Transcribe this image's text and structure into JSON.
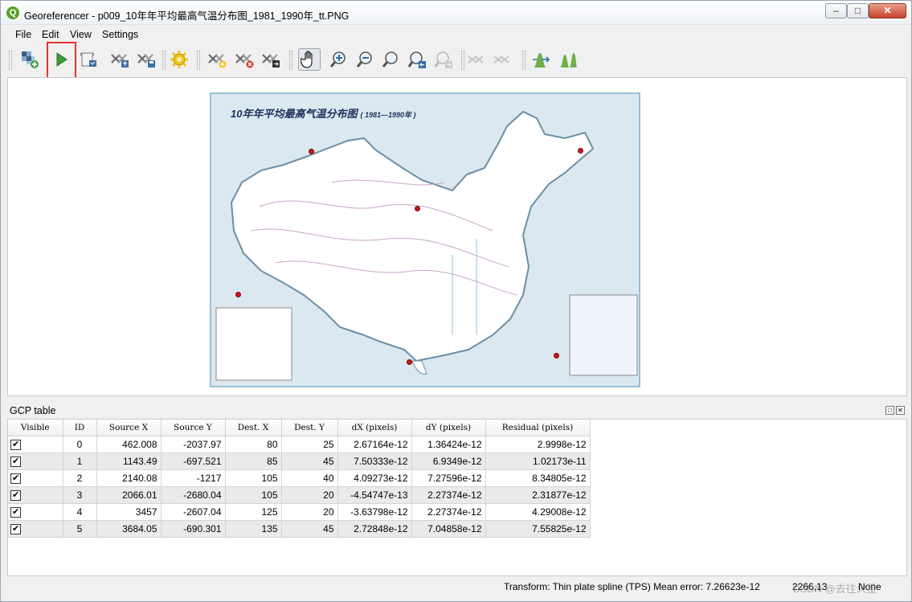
{
  "window": {
    "title": "Georeferencer - p009_10年年平均最高气温分布图_1981_1990年_tt.PNG",
    "app_icon": "Q",
    "min_glyph": "–",
    "max_glyph": "□",
    "close_glyph": "✕"
  },
  "menu": [
    "File",
    "Edit",
    "View",
    "Settings"
  ],
  "toolbar": {
    "icons": [
      "open-raster-icon",
      "start-georeferencing-icon",
      "generate-gdal-script-icon",
      "load-gcp-points-icon",
      "save-gcp-points-icon",
      "transformation-settings-icon",
      "add-point-icon",
      "delete-point-icon",
      "move-gcp-point-icon",
      "pan-icon",
      "zoom-in-icon",
      "zoom-out-icon",
      "zoom-to-layer-icon",
      "zoom-last-icon",
      "zoom-next-icon",
      "link-georeferencer-to-qgis-icon",
      "link-qgis-to-georeferencer-icon",
      "full-histogram-stretch-icon",
      "local-histogram-stretch-icon"
    ]
  },
  "map": {
    "title": "10年年平均最高气温分布图",
    "subtitle": "( 1981—1990年 )",
    "land_color": "#ffffff",
    "sea_color": "#dbe8f0",
    "border_color": "#6d8fa6",
    "point_color": "#c81818"
  },
  "gcp_table": {
    "title": "GCP table",
    "columns": [
      "Visible",
      "ID",
      "Source X",
      "Source Y",
      "Dest. X",
      "Dest. Y",
      "dX (pixels)",
      "dY (pixels)",
      "Residual (pixels)"
    ],
    "rows": [
      {
        "visible": true,
        "id": "0",
        "source_x": "462.008",
        "source_y": "-2037.97",
        "dest_x": "80",
        "dest_y": "25",
        "dx": "2.67164e-12",
        "dy": "1.36424e-12",
        "residual": "2.9998e-12"
      },
      {
        "visible": true,
        "id": "1",
        "source_x": "1143.49",
        "source_y": "-697.521",
        "dest_x": "85",
        "dest_y": "45",
        "dx": "7.50333e-12",
        "dy": "6.9349e-12",
        "residual": "1.02173e-11"
      },
      {
        "visible": true,
        "id": "2",
        "source_x": "2140.08",
        "source_y": "-1217",
        "dest_x": "105",
        "dest_y": "40",
        "dx": "4.09273e-12",
        "dy": "7.27596e-12",
        "residual": "8.34805e-12"
      },
      {
        "visible": true,
        "id": "3",
        "source_x": "2066.01",
        "source_y": "-2680.04",
        "dest_x": "105",
        "dest_y": "20",
        "dx": "-4.54747e-13",
        "dy": "2.27374e-12",
        "residual": "2.31877e-12"
      },
      {
        "visible": true,
        "id": "4",
        "source_x": "3457",
        "source_y": "-2607.04",
        "dest_x": "125",
        "dest_y": "20",
        "dx": "-3.63798e-12",
        "dy": "2.27374e-12",
        "residual": "4.29008e-12"
      },
      {
        "visible": true,
        "id": "5",
        "source_x": "3684.05",
        "source_y": "-690.301",
        "dest_x": "135",
        "dest_y": "45",
        "dx": "2.72848e-12",
        "dy": "7.04858e-12",
        "residual": "7.55825e-12"
      }
    ]
  },
  "status": {
    "transform": "Transform: Thin plate spline (TPS) Mean error: 7.26623e-12",
    "coords": "2266,13",
    "srs": "None",
    "watermark": "CSDN @去往火星"
  }
}
